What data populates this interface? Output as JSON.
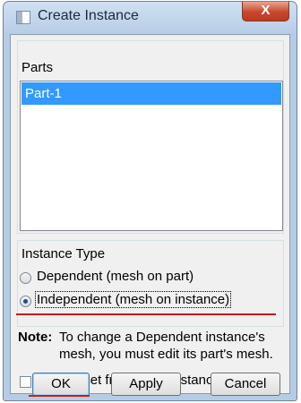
{
  "window": {
    "title": "Create Instance",
    "close_glyph": "X"
  },
  "parts": {
    "label": "Parts",
    "items": [
      "Part-1"
    ],
    "selected": "Part-1"
  },
  "instance_type": {
    "label": "Instance Type",
    "options": [
      {
        "label": "Dependent (mesh on part)",
        "checked": false
      },
      {
        "label": "Independent (mesh on instance)",
        "checked": true
      }
    ]
  },
  "note": {
    "label": "Note:",
    "line1": "To change a Dependent instance's",
    "line2": "mesh, you must edit its part's mesh."
  },
  "auto_offset": {
    "label": "Auto-offset from other instances",
    "checked": false
  },
  "buttons": {
    "ok": "OK",
    "apply": "Apply",
    "cancel": "Cancel"
  },
  "colors": {
    "selection": "#3399ff",
    "annotation_underline": "#cc1a1a"
  }
}
